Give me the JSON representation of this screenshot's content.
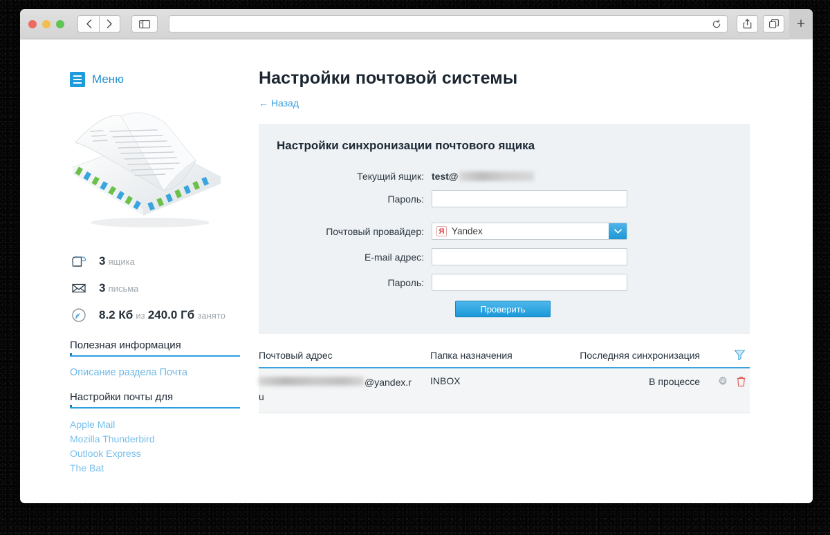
{
  "browser": {
    "back_icon": "chevron-left-icon",
    "forward_icon": "chevron-right-icon",
    "sidebar_icon": "sidebar-toggle-icon",
    "url_value": "",
    "url_placeholder": "",
    "reload_icon": "reload-icon",
    "share_icon": "share-icon",
    "tabs_icon": "show-tabs-icon",
    "newtab_label": "+"
  },
  "sidebar": {
    "menu_label": "Меню",
    "stats": [
      {
        "icon": "mailbox-icon",
        "value": "3",
        "unit": "ящика"
      },
      {
        "icon": "envelope-icon",
        "value": "3",
        "unit": "письма"
      }
    ],
    "quota": {
      "icon": "disk-usage-icon",
      "used": "8.2 Кб",
      "of": "из",
      "total": "240.0 Гб",
      "suffix": "занято"
    },
    "section_info_title": "Полезная информация",
    "info_links": [
      "Описание раздела Почта"
    ],
    "section_clients_title": "Настройки почты для",
    "client_links": [
      "Apple Mail",
      "Mozilla Thunderbird",
      "Outlook Express",
      "The Bat"
    ]
  },
  "main": {
    "title": "Настройки почтовой системы",
    "back_label": "← Назад",
    "panel": {
      "title": "Настройки синхронизации почтового ящика",
      "current_mailbox_label": "Текущий ящик:",
      "current_mailbox_value": "test@",
      "current_mailbox_redacted": true,
      "password_label": "Пароль:",
      "password_value": "",
      "provider_label": "Почтовый провайдер:",
      "provider_value": "Yandex",
      "provider_logo": "yandex-logo-icon",
      "provider_arrow": "chevron-down-icon",
      "email_label": "E-mail адрес:",
      "email_value": "",
      "password2_label": "Пароль:",
      "password2_value": "",
      "check_button": "Проверить"
    },
    "table": {
      "columns": [
        "Почтовый адрес",
        "Папка назначения",
        "Последняя синхронизация"
      ],
      "filter_icon": "filter-icon",
      "rows": [
        {
          "address_redacted": true,
          "address_suffix": "@yandex.r",
          "address_wrap": "u",
          "folder": "INBOX",
          "last_sync": "В процессе",
          "settings_icon": "gear-icon",
          "delete_icon": "trash-icon"
        }
      ]
    }
  },
  "colors": {
    "accent": "#2b9fe0",
    "link": "#3ca0dd",
    "panel_bg": "#eef2f5",
    "button": "#1a97d8",
    "delete": "#d9534f",
    "yandex_red": "#e23a3a"
  }
}
